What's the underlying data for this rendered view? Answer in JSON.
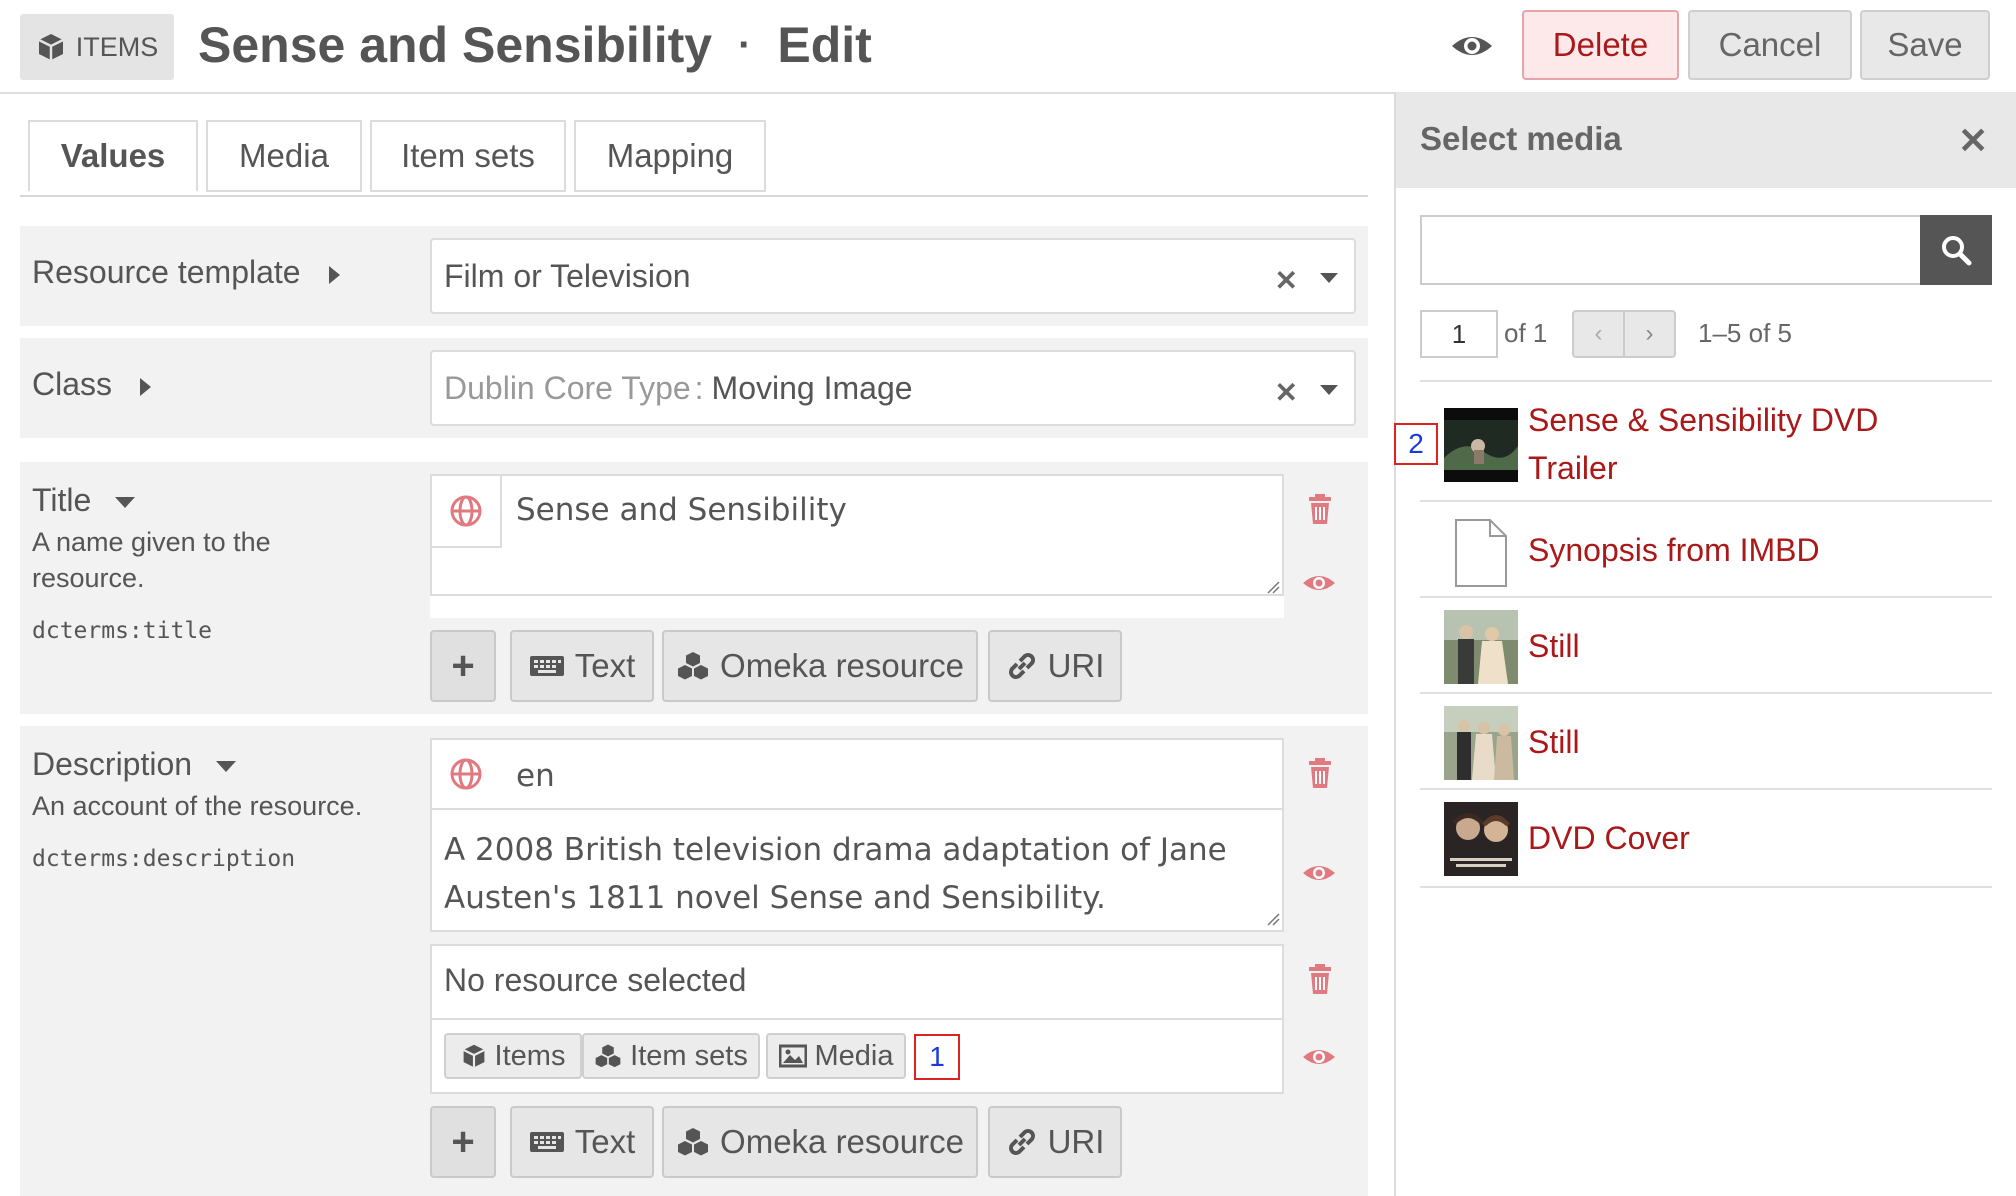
{
  "header": {
    "badge_label": "ITEMS",
    "title": "Sense and Sensibility",
    "title_sep": "·",
    "mode": "Edit",
    "buttons": {
      "delete": "Delete",
      "cancel": "Cancel",
      "save": "Save"
    }
  },
  "tabs": [
    {
      "label": "Values",
      "active": true
    },
    {
      "label": "Media",
      "active": false
    },
    {
      "label": "Item sets",
      "active": false
    },
    {
      "label": "Mapping",
      "active": false
    }
  ],
  "resource_template": {
    "label": "Resource template",
    "value": "Film or Television"
  },
  "class": {
    "label": "Class",
    "prefix": "Dublin Core Type",
    "colon": ":",
    "value": "Moving Image"
  },
  "title_field": {
    "label": "Title",
    "description": "A name given to the resource.",
    "term": "dcterms:title",
    "value": "Sense and Sensibility",
    "add_buttons": {
      "text": "Text",
      "resource": "Omeka resource",
      "uri": "URI"
    }
  },
  "description_field": {
    "label": "Description",
    "description": "An account of the resource.",
    "term": "dcterms:description",
    "language": "en",
    "value": "A 2008 British television drama adaptation of Jane Austen's 1811 novel Sense and Sensibility.",
    "resource_placeholder": "No resource selected",
    "resource_buttons": {
      "items": "Items",
      "item_sets": "Item sets",
      "media": "Media"
    },
    "add_buttons": {
      "text": "Text",
      "resource": "Omeka resource",
      "uri": "URI"
    }
  },
  "annotations": {
    "one": "1",
    "two": "2"
  },
  "sidebar": {
    "title": "Select media",
    "close": "✕",
    "page_value": "1",
    "page_of": "of 1",
    "range": "1–5 of 5",
    "media": [
      {
        "title_line1": "Sense & Sensibility DVD",
        "title_line2": "Trailer",
        "thumb": "video-thumbnail"
      },
      {
        "title_line1": "Synopsis from IMBD",
        "thumb": "document-icon"
      },
      {
        "title_line1": "Still",
        "thumb": "still-thumbnail"
      },
      {
        "title_line1": "Still",
        "thumb": "still-thumbnail"
      },
      {
        "title_line1": "DVD Cover",
        "thumb": "cover-thumbnail"
      }
    ]
  },
  "colors": {
    "accent_red": "#a91919",
    "icon_red": "#e07a80",
    "dark": "#555555"
  }
}
